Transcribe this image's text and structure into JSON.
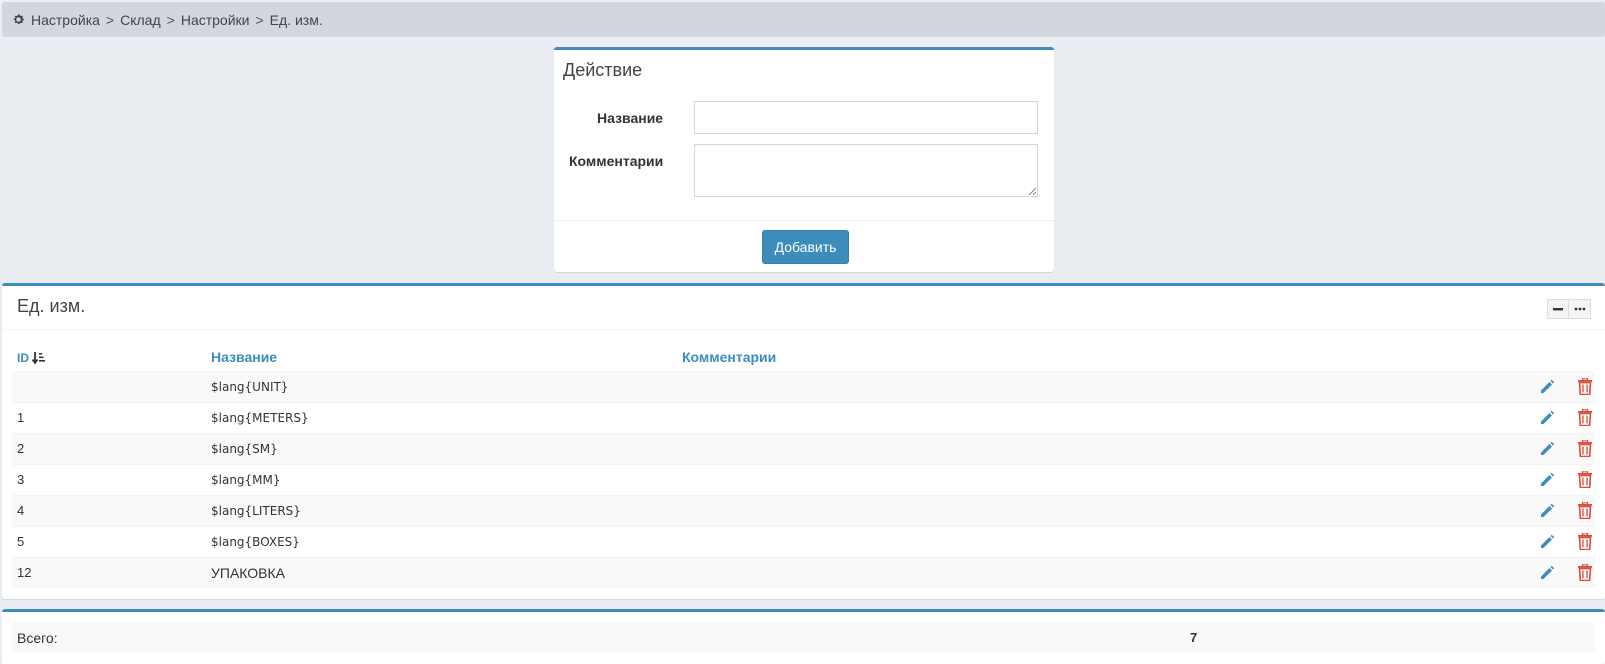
{
  "breadcrumb": {
    "icon": "gear-icon",
    "items": [
      "Настройка",
      "Склад",
      "Настройки",
      "Ед. изм."
    ],
    "separator": ">"
  },
  "action_form": {
    "title": "Действие",
    "name_label": "Название",
    "name_value": "",
    "comment_label": "Комментарии",
    "comment_value": "",
    "submit_label": "Добавить"
  },
  "units": {
    "title": "Ед. изм.",
    "columns": {
      "id": "ID",
      "name": "Название",
      "comment": "Комментарии"
    },
    "rows": [
      {
        "id": "",
        "name": "$lang{UNIT}",
        "comment": ""
      },
      {
        "id": "1",
        "name": "$lang{METERS}",
        "comment": ""
      },
      {
        "id": "2",
        "name": "$lang{SM}",
        "comment": ""
      },
      {
        "id": "3",
        "name": "$lang{MM}",
        "comment": ""
      },
      {
        "id": "4",
        "name": "$lang{LITERS}",
        "comment": ""
      },
      {
        "id": "5",
        "name": "$lang{BOXES}",
        "comment": ""
      },
      {
        "id": "12",
        "name": "УПАКОВКА",
        "comment": ""
      }
    ]
  },
  "summary": {
    "label": "Всего:",
    "value": "7"
  },
  "colors": {
    "accent": "#3c8dbc",
    "delete": "#dd4b39",
    "breadcrumb_bg": "#d2d6de",
    "page_bg": "#eaedf2"
  }
}
